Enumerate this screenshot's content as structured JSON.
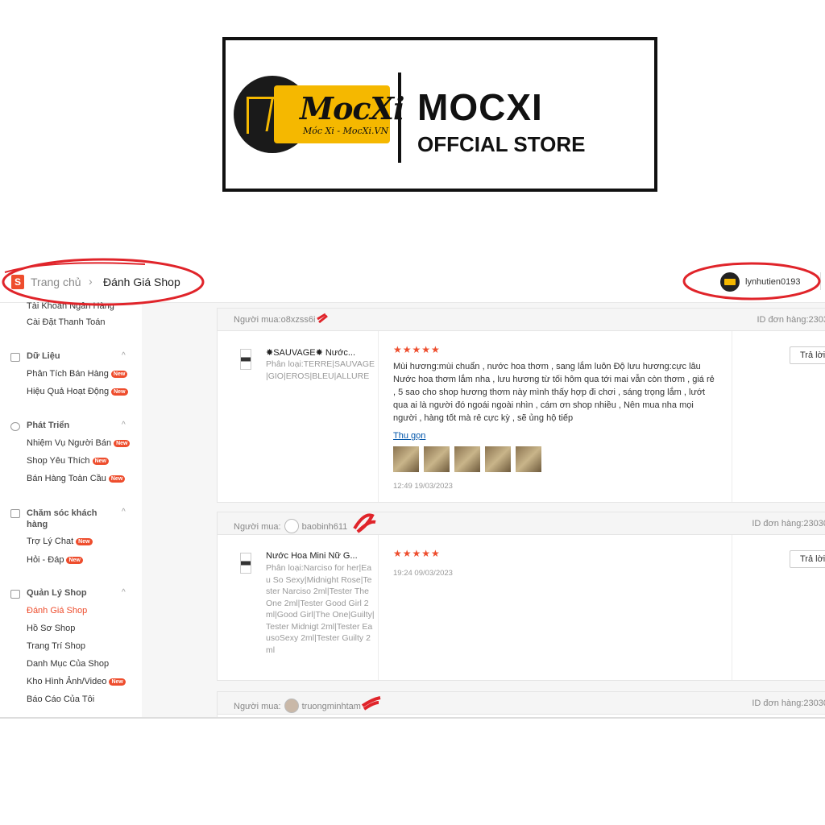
{
  "banner": {
    "logo_word": "MocXi",
    "logo_sub": "Móc Xi - MocXi.VN",
    "brand_name": "MOCXI",
    "brand_sub": "OFFCIAL STORE"
  },
  "colors": {
    "accent": "#ee4d2d",
    "annotation": "#e0242a",
    "logo_yellow": "#f5b800"
  },
  "topbar": {
    "logo_letter": "S",
    "breadcrumb_home": "Trang chủ",
    "breadcrumb_sep": "›",
    "breadcrumb_current": "Đánh Giá Shop",
    "username": "lynhutien0193"
  },
  "sidebar": {
    "clipped_item": "Tài Khoản Ngân Hàng",
    "payment_settings": "Cài Đặt Thanh Toán",
    "sections": [
      {
        "title": "Dữ Liệu",
        "icon": "chart-icon",
        "items": [
          "Phân Tích Bán Hàng",
          "Hiệu Quả Hoạt Động"
        ]
      },
      {
        "title": "Phát Triển",
        "icon": "growth-icon",
        "items": [
          "Nhiệm Vụ Người Bán",
          "Shop Yêu Thích",
          "Bán Hàng Toàn Cầu"
        ]
      },
      {
        "title": "Chăm sóc khách hàng",
        "icon": "chat-icon",
        "items": [
          "Trợ Lý Chat",
          "Hỏi - Đáp"
        ]
      },
      {
        "title": "Quản Lý Shop",
        "icon": "shop-icon",
        "items": [
          "Đánh Giá Shop",
          "Hồ Sơ Shop",
          "Trang Trí Shop",
          "Danh Mục Của Shop",
          "Kho Hình Ảnh/Video",
          "Báo Cáo Của Tôi"
        ]
      }
    ],
    "badge": "New",
    "chevron": "^"
  },
  "reviews": [
    {
      "buyer_label": "Người mua:",
      "buyer": "o8xzss6i",
      "order_label": "ID đơn hàng:2303",
      "product_name": "✸SAUVAGE✸ Nước...",
      "variation": "Phân loại:TERRE|SAUVAGE|GIO|EROS|BLEU|ALLURE",
      "rating": "★★★★★",
      "comment": "Mùi hương:mùi chuẩn , nước hoa thơm , sang lắm luôn Độ lưu hương:cực lâu Nước hoa thơm lắm nha , lưu hương từ tối hôm qua tới mai vẫn còn thơm , giá rẻ , 5 sao cho shop hương thơm này mình thấy hợp đi chơi , sáng trọng lắm , lướt qua ai là người đó ngoái ngoài nhìn , cám ơn shop nhiều , Nên mua nha mọi người , hàng tốt mà rẻ cực kỳ , sẽ ủng hộ tiếp",
      "collapse_link": "Thu gọn",
      "photo_count": 5,
      "time": "12:49 19/03/2023",
      "reply": "Trả lời"
    },
    {
      "buyer_label": "Người mua:",
      "buyer": "baobinh611",
      "order_label": "ID đơn hàng:23030",
      "product_name": "Nước Hoa Mini Nữ G...",
      "variation": "Phân loại:Narciso for her|Eau So Sexy|Midnight Rose|Tester Narciso 2ml|Tester The One 2ml|Tester Good Girl 2ml|Good Girl|The One|Guilty|Tester Midnigt 2ml|Tester EausoSexy 2ml|Tester Guilty 2ml",
      "rating": "★★★★★",
      "time": "19:24 09/03/2023",
      "reply": "Trả lời"
    },
    {
      "buyer_label": "Người mua:",
      "buyer": "truongminhtam",
      "order_label": "ID đơn hàng:23030"
    }
  ]
}
